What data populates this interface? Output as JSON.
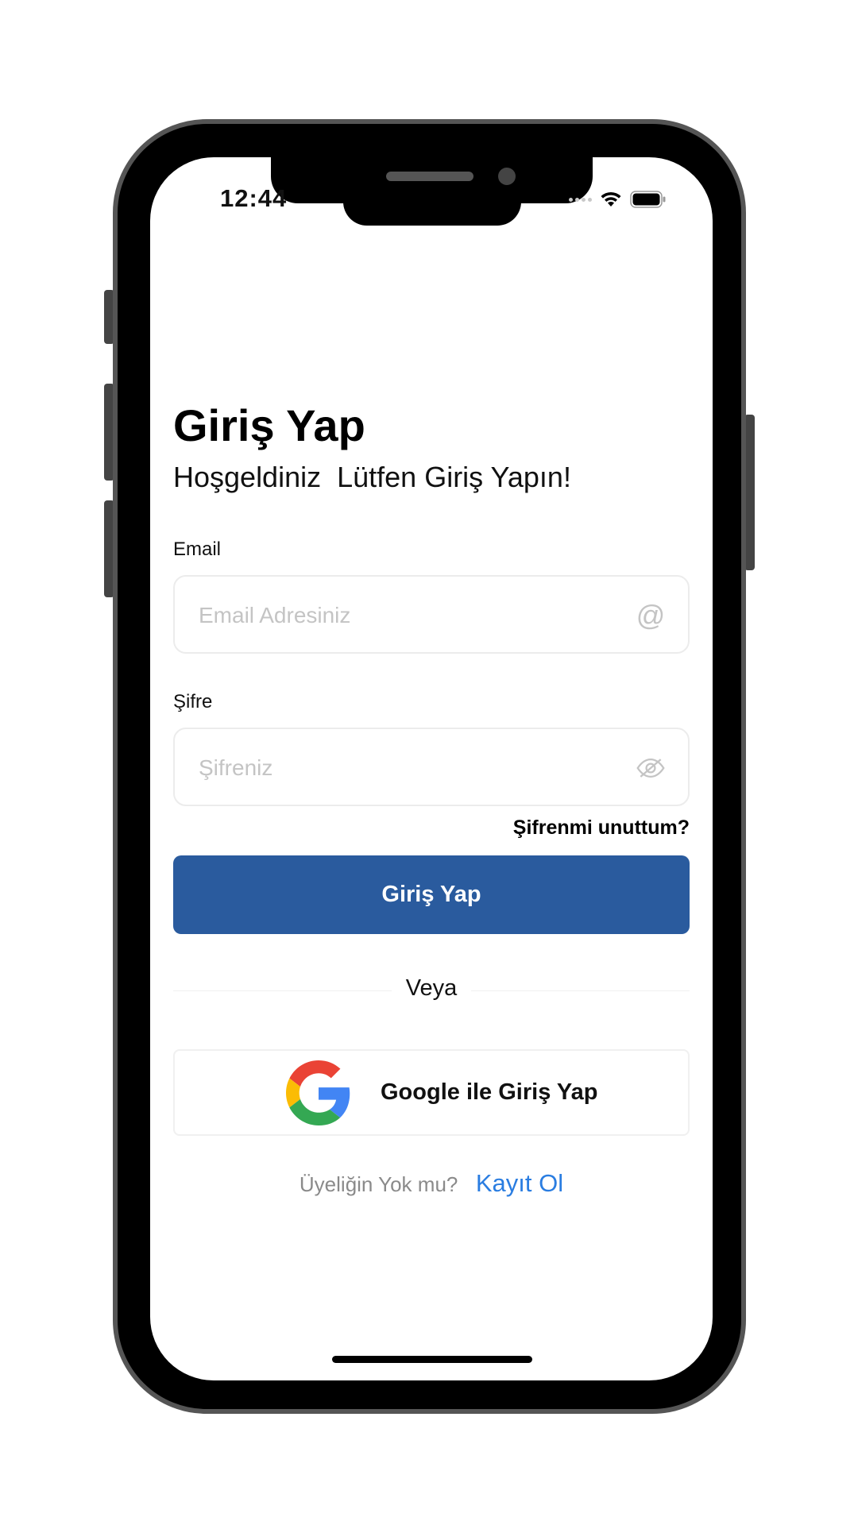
{
  "status_bar": {
    "time": "12:44",
    "signal_icon": "signal-dots-icon",
    "wifi_icon": "wifi-icon",
    "battery_icon": "battery-icon"
  },
  "login": {
    "title": "Giriş Yap",
    "subtitle": "Hoşgeldiniz  Lütfen Giriş Yapın!",
    "email": {
      "label": "Email",
      "value": "",
      "placeholder": "Email Adresiniz",
      "icon": "at-icon"
    },
    "password": {
      "label": "Şifre",
      "value": "",
      "placeholder": "Şifreniz",
      "icon": "eye-off-icon"
    },
    "forgot_password": "Şifrenmi unuttum?",
    "submit_label": "Giriş Yap",
    "divider_text": "Veya",
    "google": {
      "label": "Google ile Giriş Yap",
      "icon": "google-logo-icon"
    },
    "signup": {
      "prompt": "Üyeliğin Yok mu?",
      "link": "Kayıt Ol"
    }
  },
  "colors": {
    "primary_button": "#2a5b9e",
    "link": "#2a7de1",
    "placeholder": "#c4c4c4"
  }
}
